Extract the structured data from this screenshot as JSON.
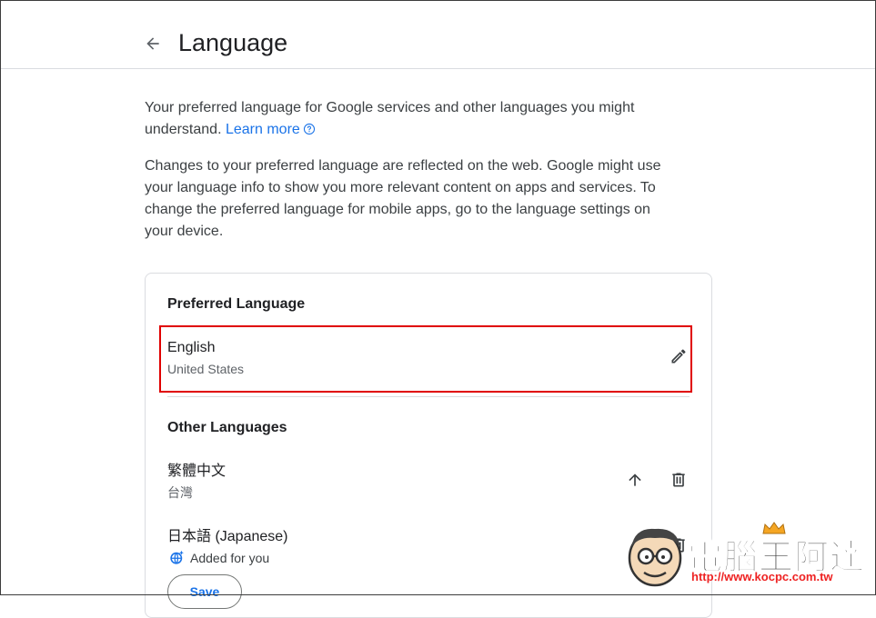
{
  "header": {
    "title": "Language",
    "back_icon": "arrow-back-icon"
  },
  "intro": {
    "p1_text": "Your preferred language for Google services and other languages you might understand.",
    "learn_more": "Learn more",
    "p2_text": "Changes to your preferred language are reflected on the web. Google might use your language info to show you more relevant content on apps and services. To change the preferred language for mobile apps, go to the language settings on your device."
  },
  "preferred": {
    "title": "Preferred Language",
    "language": "English",
    "region": "United States",
    "edit_icon": "pencil-icon"
  },
  "other": {
    "title": "Other Languages",
    "items": [
      {
        "language": "繁體中文",
        "region": "台灣"
      },
      {
        "language": "日本語 (Japanese)",
        "note": "Added for you",
        "save_label": "Save"
      }
    ]
  },
  "watermark": {
    "text": "電腦王阿達",
    "url": "http://www.kocpc.com.tw"
  },
  "colors": {
    "accent": "#1a73e8",
    "highlight": "#e00000",
    "text": "#202124",
    "subtext": "#5f6368"
  }
}
